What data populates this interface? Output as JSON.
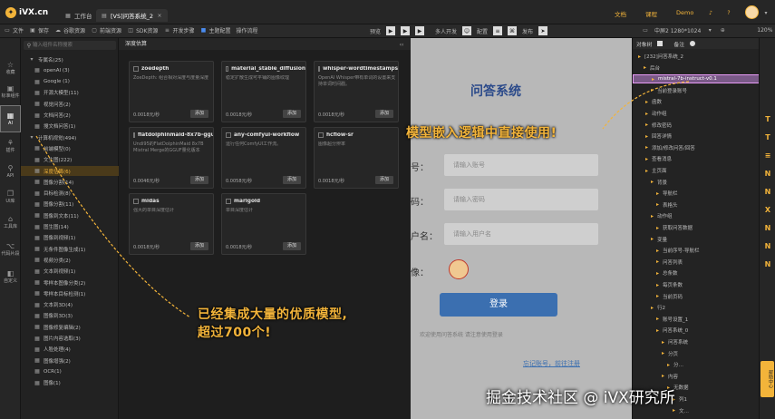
{
  "topbar": {
    "logo_text": "iVX.cn",
    "tabs": [
      {
        "label": "工作台"
      },
      {
        "label": "[VS]问答系统_2"
      }
    ],
    "links": {
      "docs": "文档",
      "course": "课程",
      "demo": "Demo"
    }
  },
  "toolbar": {
    "left_items": [
      {
        "label": "文件"
      },
      {
        "label": "保存"
      },
      {
        "label": "谷歌资源"
      },
      {
        "label": "前端资源"
      },
      {
        "label": "SDK资源"
      },
      {
        "label": "开发步骤"
      },
      {
        "label": "主题配置"
      },
      {
        "label": "操作流程"
      }
    ],
    "preview_label": "预览",
    "multi_dev_label": "多人开发",
    "config_label": "配置",
    "publish_label": "发布",
    "device_label": "中屏2 1280*1024",
    "zoom_label": "120%"
  },
  "leftrail": {
    "items": [
      {
        "label": "收藏"
      },
      {
        "label": "标准组件"
      },
      {
        "label": "AI"
      },
      {
        "label": "插件"
      },
      {
        "label": "API"
      },
      {
        "label": "UI库"
      },
      {
        "label": "工具库"
      },
      {
        "label": "代码片段"
      },
      {
        "label": "自定义"
      }
    ]
  },
  "sidelist": {
    "search_placeholder": "输入组件名称搜索",
    "rows": [
      {
        "label": "专属名(25)",
        "level": 1
      },
      {
        "label": "openAI (3)",
        "level": 2
      },
      {
        "label": "Google (1)",
        "level": 2
      },
      {
        "label": "开源大模型(11)",
        "level": 2
      },
      {
        "label": "视觉问答(2)",
        "level": 2
      },
      {
        "label": "文档问答(2)",
        "level": 2
      },
      {
        "label": "搜文档问答(1)",
        "level": 2
      },
      {
        "label": "计算机视觉(494)",
        "level": 1
      },
      {
        "label": "前端模型(0)",
        "level": 2
      },
      {
        "label": "文生图(222)",
        "level": 2
      },
      {
        "label": "深度估算(6)",
        "level": 2
      },
      {
        "label": "图像分割(14)",
        "level": 2
      },
      {
        "label": "目标检测(8)",
        "level": 2
      },
      {
        "label": "图像分割(11)",
        "level": 2
      },
      {
        "label": "图像到文本(11)",
        "level": 2
      },
      {
        "label": "图生图(14)",
        "level": 2
      },
      {
        "label": "图像到视频(1)",
        "level": 2
      },
      {
        "label": "无条件图像生成(1)",
        "level": 2
      },
      {
        "label": "视频分类(2)",
        "level": 2
      },
      {
        "label": "文本到视频(1)",
        "level": 2
      },
      {
        "label": "零样本图像分类(2)",
        "level": 2
      },
      {
        "label": "零样本目标检测(1)",
        "level": 2
      },
      {
        "label": "文本到3D(4)",
        "level": 2
      },
      {
        "label": "图像到3D(3)",
        "level": 2
      },
      {
        "label": "图像修复编辑(2)",
        "level": 2
      },
      {
        "label": "图片内容选取(3)",
        "level": 2
      },
      {
        "label": "人脸处理(4)",
        "level": 2
      },
      {
        "label": "图像增强(2)",
        "level": 2
      },
      {
        "label": "OCR(1)",
        "level": 2
      },
      {
        "label": "图像(1)",
        "level": 2
      }
    ]
  },
  "panel": {
    "title": "深度估算",
    "cards": [
      {
        "name": "zoedepth",
        "desc": "ZoeDepth: 组合相对深度与度量深度",
        "price": "0.0018元/秒",
        "add_label": "添加"
      },
      {
        "name": "material_stable_diffusion",
        "desc": "稳定扩散生成可平铺的图像纹理",
        "price": "0.0018元/秒",
        "add_label": "添加"
      },
      {
        "name": "whisper-wordtimestamps",
        "desc": "OpenAI Whisper带有单词的设置来支持单词时间戳。",
        "price": "0.0018元/秒",
        "add_label": "添加"
      },
      {
        "name": "flatdolphinmaid-8x7b-gguf",
        "desc": "Undi95的FlatDolphinMaid 8x7B Mixtral Merge的GGUF量化版本",
        "price": "0.0046元/秒",
        "add_label": "添加"
      },
      {
        "name": "any-comfyui-workflow",
        "desc": "运行任何ComfyUI工作流。",
        "price": "0.0058元/秒",
        "add_label": "添加"
      },
      {
        "name": "hcflow-sr",
        "desc": "图像超分辨率",
        "price": "0.0018元/秒",
        "add_label": "添加"
      },
      {
        "name": "midas",
        "desc": "强大的单目深度估计",
        "price": "0.0018元/秒",
        "add_label": "添加"
      },
      {
        "name": "marigold",
        "desc": "单目深度估计",
        "price": "0.0018元/秒",
        "add_label": "添加"
      }
    ]
  },
  "canvas": {
    "app_title": "问答系统",
    "label_account": "号：",
    "label_password": "码：",
    "label_username": "户名：",
    "label_avatar": "像：",
    "placeholder_account": "请输入账号",
    "placeholder_password": "请输入密码",
    "placeholder_username": "请输入用户名",
    "login_button": "登录",
    "footer_text": "欢迎使用问答系统 请注意使用登录",
    "footer_link": "忘记账号，前往注册"
  },
  "rightpanel": {
    "tab_objects": "对象树",
    "tab_notes": "备注",
    "rows": [
      {
        "label": "[232]问答系统_2",
        "indent": 4
      },
      {
        "label": "后台",
        "indent": 10
      },
      {
        "label": "mistral-7b-instruct-v0.1",
        "indent": 18,
        "highlight": true
      },
      {
        "label": "当前登录账号",
        "indent": 18
      },
      {
        "label": "函数",
        "indent": 12
      },
      {
        "label": "动作组",
        "indent": 12
      },
      {
        "label": "修改密码",
        "indent": 12
      },
      {
        "label": "回答详情",
        "indent": 12
      },
      {
        "label": "添加/修改问答/回答",
        "indent": 12
      },
      {
        "label": "查看消息",
        "indent": 12
      },
      {
        "label": "主页面",
        "indent": 12
      },
      {
        "label": "背景",
        "indent": 18
      },
      {
        "label": "导航栏",
        "indent": 24
      },
      {
        "label": "表格头",
        "indent": 24
      },
      {
        "label": "动作组",
        "indent": 18
      },
      {
        "label": "获取问答数据",
        "indent": 24
      },
      {
        "label": "变量",
        "indent": 18
      },
      {
        "label": "当前序号-导航栏",
        "indent": 24
      },
      {
        "label": "问答列表",
        "indent": 24
      },
      {
        "label": "总条数",
        "indent": 24
      },
      {
        "label": "每页条数",
        "indent": 24
      },
      {
        "label": "当前页码",
        "indent": 24
      },
      {
        "label": "行2",
        "indent": 18
      },
      {
        "label": "账号设置_1",
        "indent": 24
      },
      {
        "label": "问答系统_0",
        "indent": 24
      },
      {
        "label": "问答系统",
        "indent": 30
      },
      {
        "label": "分页",
        "indent": 30
      },
      {
        "label": "分…",
        "indent": 36
      },
      {
        "label": "内容",
        "indent": 30
      },
      {
        "label": "无数据",
        "indent": 36
      },
      {
        "label": "列1",
        "indent": 42
      },
      {
        "label": "文…",
        "indent": 42
      }
    ]
  },
  "callouts": {
    "embed": "模型嵌入逻辑中直接使用!",
    "integrated_line1": "已经集成大量的优质模型,",
    "integrated_line2": "超过700个!"
  },
  "watermark": "掘金技术社区 @ iVX研究所",
  "feedback_label": "帮助中心",
  "colors": {
    "accent": "#f3b43a",
    "highlight": "#7a5a88",
    "login_button": "#3b6fb0"
  }
}
